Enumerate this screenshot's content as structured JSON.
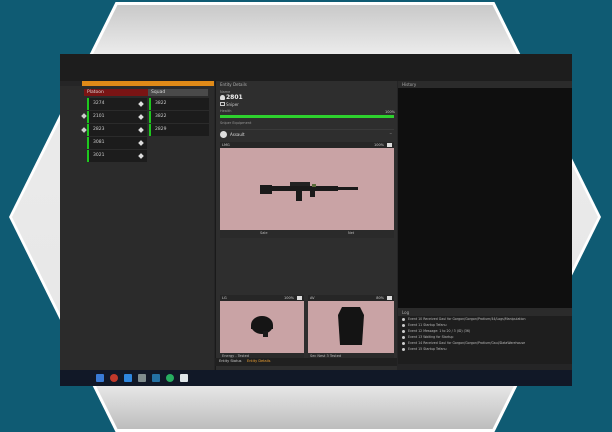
{
  "roster": {
    "header_left": "Platoon",
    "header_right": "Squad",
    "list1": [
      "3274",
      "2101",
      "2823",
      "3081",
      "3021"
    ],
    "list2": [
      "3822",
      "3822",
      "2829"
    ]
  },
  "center": {
    "panel_title": "Entity Details",
    "name_label": "Name",
    "operator_id": "2801",
    "role": "Sniper",
    "health_label": "Health",
    "health_value": "100%",
    "health_pct": 1.0,
    "equipment_label": "Sniper Equipment",
    "kit_name": "Assault",
    "cards": {
      "rifle": {
        "title": "LMG",
        "status": "100%",
        "foot_left": "Sale",
        "foot_right": "Net"
      },
      "helmet": {
        "title": "LG",
        "status": "100%",
        "foot": "Energy - Tested"
      },
      "vest": {
        "title": "AV",
        "status": "80%",
        "foot": "Sec Nest 3 Tested"
      }
    },
    "tabs": [
      "Entity Status",
      "Entity Details"
    ]
  },
  "right": {
    "history_title": "History",
    "log_title": "Log",
    "log_rows": [
      "Event 10   Received Gaul for Gorgon/Gorgon/Protium/44/Logs/Manipulation",
      "Event 11   Startup Tefanu",
      "Event 12   Message: 1 to 20 / 3 (ID) (36)",
      "Event 13   Waiting for Startup",
      "Event 14   Received Gaul for Gorgon/Gorgon/Protium/Gaul/DataWarehouse",
      "Event 15   Startup Tefanu"
    ]
  },
  "colors": {
    "accent_orange": "#e08a18",
    "health_green": "#2ed12e",
    "roster_green": "#1ec81e",
    "platoon_red": "#7a1414",
    "background_teal": "#0f5b73"
  }
}
